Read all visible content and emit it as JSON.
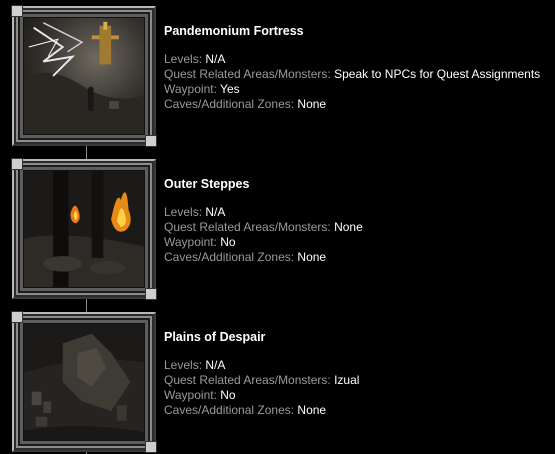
{
  "areas": [
    {
      "title": "Pandemonium Fortress",
      "thumbnail": "pandemonium-fortress-scene",
      "fields": [
        {
          "label": "Levels:",
          "value": "N/A"
        },
        {
          "label": "Quest Related Areas/Monsters:",
          "value": "Speak to NPCs for Quest Assignments"
        },
        {
          "label": "Waypoint:",
          "value": "Yes"
        },
        {
          "label": "Caves/Additional Zones:",
          "value": "None"
        }
      ]
    },
    {
      "title": "Outer Steppes",
      "thumbnail": "outer-steppes-scene",
      "fields": [
        {
          "label": "Levels:",
          "value": "N/A"
        },
        {
          "label": "Quest Related Areas/Monsters:",
          "value": "None"
        },
        {
          "label": "Waypoint:",
          "value": "No"
        },
        {
          "label": "Caves/Additional Zones:",
          "value": "None"
        }
      ]
    },
    {
      "title": "Plains of Despair",
      "thumbnail": "plains-of-despair-scene",
      "fields": [
        {
          "label": "Levels:",
          "value": "N/A"
        },
        {
          "label": "Quest Related Areas/Monsters:",
          "value": "Izual"
        },
        {
          "label": "Waypoint:",
          "value": "No"
        },
        {
          "label": "Caves/Additional Zones:",
          "value": "None"
        }
      ]
    }
  ]
}
